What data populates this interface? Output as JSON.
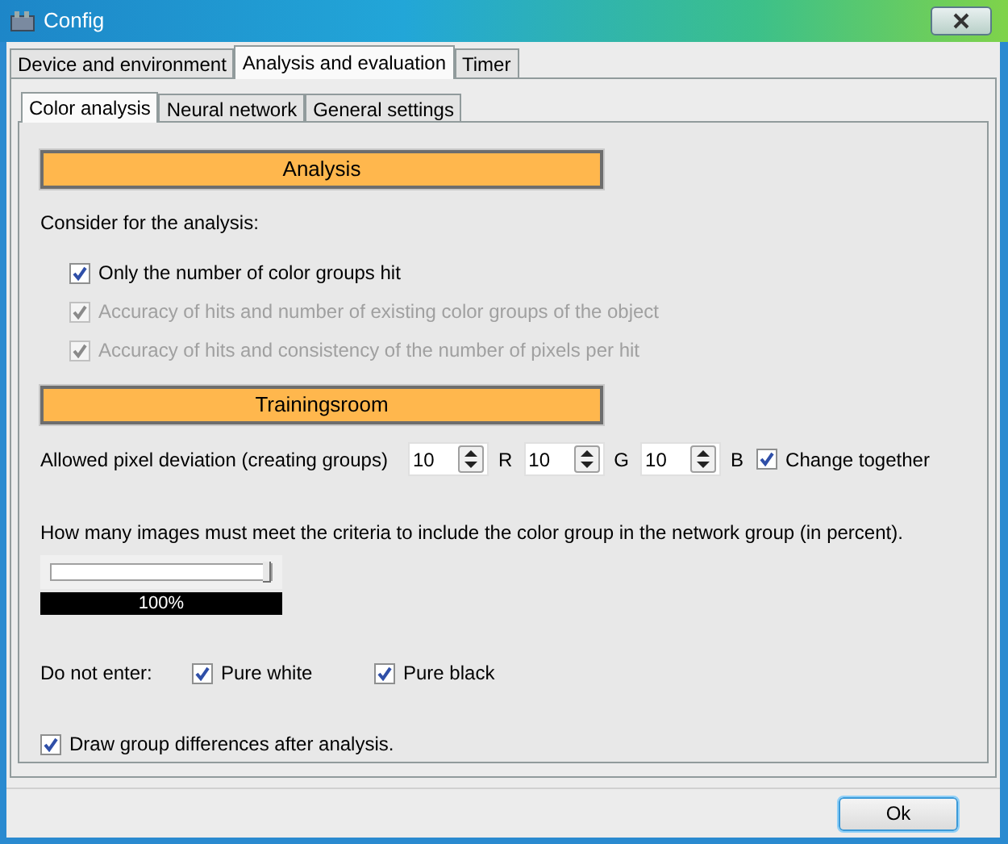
{
  "window": {
    "title": "Config"
  },
  "tabs": [
    {
      "label": "Device and environment",
      "selected": false
    },
    {
      "label": "Analysis and evaluation",
      "selected": true
    },
    {
      "label": "Timer",
      "selected": false
    }
  ],
  "subtabs": [
    {
      "label": "Color analysis",
      "selected": true
    },
    {
      "label": "Neural network",
      "selected": false
    },
    {
      "label": "General settings",
      "selected": false
    }
  ],
  "analysis": {
    "header": "Analysis",
    "prompt": "Consider for the analysis:",
    "options": [
      {
        "label": "Only the number of color groups hit",
        "checked": true,
        "disabled": false
      },
      {
        "label": "Accuracy of hits and number of existing color groups of the object",
        "checked": true,
        "disabled": true
      },
      {
        "label": "Accuracy of hits and consistency of the number of pixels per hit",
        "checked": true,
        "disabled": true
      }
    ]
  },
  "trainingsroom": {
    "header": "Trainingsroom",
    "deviation": {
      "label": "Allowed pixel deviation (creating groups)",
      "channels": [
        {
          "value": "10",
          "suffix": "R"
        },
        {
          "value": "10",
          "suffix": "G"
        },
        {
          "value": "10",
          "suffix": "B"
        }
      ],
      "change_together": {
        "label": "Change together",
        "checked": true
      }
    },
    "criteria": {
      "label": "How many images must meet the criteria to include the color group in the network group (in percent).",
      "slider": {
        "level": 1
      },
      "reading": "100%"
    },
    "do_not_enter": {
      "label": "Do not enter:",
      "options": [
        {
          "label": "Pure white",
          "checked": true
        },
        {
          "label": "Pure black",
          "checked": true
        }
      ]
    },
    "draw_differences": {
      "label": "Draw group differences after analysis.",
      "checked": true
    }
  },
  "buttons": [
    "Ok"
  ]
}
